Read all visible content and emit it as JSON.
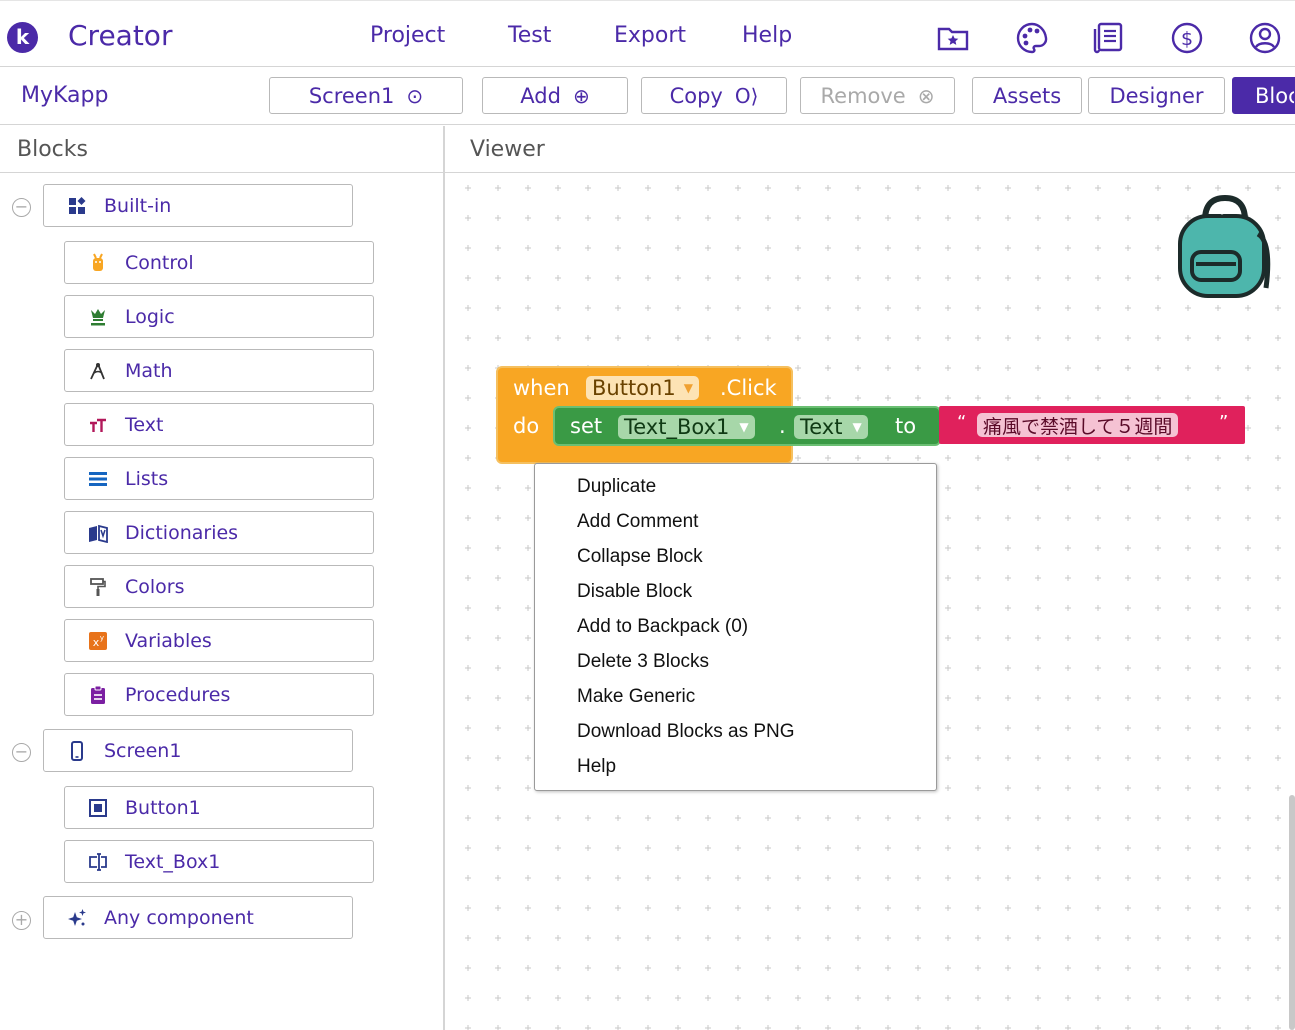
{
  "app": {
    "logo_letter": "k",
    "name": "Creator"
  },
  "menu": {
    "project": "Project",
    "test": "Test",
    "export": "Export",
    "help": "Help"
  },
  "top_icons": [
    "folder-star-icon",
    "palette-icon",
    "news-icon",
    "dollar-icon",
    "account-icon"
  ],
  "toolbar": {
    "project_name": "MyKapp",
    "screen": "Screen1",
    "add": "Add",
    "copy": "Copy",
    "remove": "Remove",
    "assets": "Assets",
    "designer": "Designer",
    "blocks": "Blocks"
  },
  "panels": {
    "blocks_title": "Blocks",
    "viewer_title": "Viewer"
  },
  "tree": {
    "builtin": {
      "label": "Built-in",
      "toggle": "−",
      "items": [
        {
          "label": "Control",
          "icon": "control-icon",
          "color": "#f8a623"
        },
        {
          "label": "Logic",
          "icon": "logic-icon",
          "color": "#2e7d32"
        },
        {
          "label": "Math",
          "icon": "math-icon",
          "color": "#333333"
        },
        {
          "label": "Text",
          "icon": "text-icon",
          "color": "#b2185a"
        },
        {
          "label": "Lists",
          "icon": "lists-icon",
          "color": "#1565c0"
        },
        {
          "label": "Dictionaries",
          "icon": "dictionaries-icon",
          "color": "#2a3a8c"
        },
        {
          "label": "Colors",
          "icon": "colors-icon",
          "color": "#555555"
        },
        {
          "label": "Variables",
          "icon": "variables-icon",
          "color": "#e8731a"
        },
        {
          "label": "Procedures",
          "icon": "procedures-icon",
          "color": "#7b1fa2"
        }
      ]
    },
    "screen": {
      "label": "Screen1",
      "toggle": "−",
      "items": [
        {
          "label": "Button1",
          "icon": "button-icon"
        },
        {
          "label": "Text_Box1",
          "icon": "textbox-icon"
        }
      ]
    },
    "any": {
      "label": "Any component",
      "toggle": "+"
    }
  },
  "blocks": {
    "event": {
      "when": "when",
      "component": "Button1",
      "event": ".Click",
      "do": "do"
    },
    "set": {
      "set": "set",
      "component": "Text_Box1",
      "dot": ".",
      "property": "Text",
      "to": "to"
    },
    "text": {
      "open_quote": "“",
      "value": "痛風で禁酒して５週間",
      "close_quote": "”"
    }
  },
  "context_menu": [
    "Duplicate",
    "Add Comment",
    "Collapse Block",
    "Disable Block",
    "Add to Backpack (0)",
    "Delete 3 Blocks",
    "Make Generic",
    "Download Blocks as PNG",
    "Help"
  ]
}
